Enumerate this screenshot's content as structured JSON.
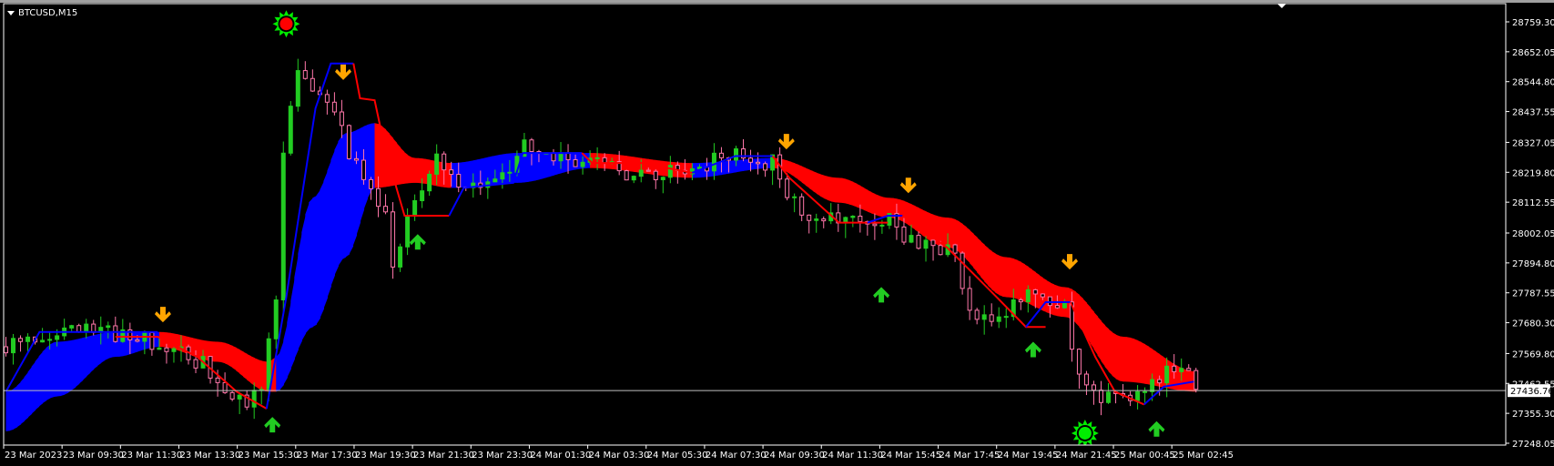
{
  "window": {
    "symbol_title": "BTCUSD,M15"
  },
  "colors": {
    "bull": "#22cc22",
    "bear": "#ff77aa",
    "ribbon_up": "#0000ff",
    "ribbon_down": "#ff0000",
    "arrow_down": "#ffa500",
    "arrow_up": "#22cc22",
    "grid_line": "#c0c0c0"
  },
  "chart_data": {
    "type": "candlestick",
    "symbol": "BTCUSD",
    "timeframe": "M15",
    "ylim": [
      27248.05,
      28759.3
    ],
    "y_ticks": [
      "28759.30",
      "28652.05",
      "28544.80",
      "28437.55",
      "28327.05",
      "28219.80",
      "28112.55",
      "28002.05",
      "27894.80",
      "27787.55",
      "27680.30",
      "27569.80",
      "27462.55",
      "27355.30",
      "27248.05"
    ],
    "current_price": "27436.76",
    "x_labels": [
      "23 Mar 2023",
      "23 Mar 09:30",
      "23 Mar 11:30",
      "23 Mar 13:30",
      "23 Mar 15:30",
      "23 Mar 17:30",
      "23 Mar 19:30",
      "23 Mar 21:30",
      "23 Mar 23:30",
      "24 Mar 01:30",
      "24 Mar 03:30",
      "24 Mar 05:30",
      "24 Mar 07:30",
      "24 Mar 09:30",
      "24 Mar 11:30",
      "24 Mar 15:45",
      "24 Mar 17:45",
      "24 Mar 19:45",
      "24 Mar 21:45",
      "25 Mar 00:45",
      "25 Mar 02:45"
    ],
    "bars_per_label": 8,
    "bar_count": 164,
    "price_path": [
      [
        0,
        27594
      ],
      [
        6,
        27647
      ],
      [
        13,
        27647
      ],
      [
        21,
        27612
      ],
      [
        26,
        27540
      ],
      [
        32,
        27398
      ],
      [
        35,
        27416
      ],
      [
        37,
        27772
      ],
      [
        38,
        28307
      ],
      [
        40,
        28556
      ],
      [
        42,
        28503
      ],
      [
        45,
        28449
      ],
      [
        48,
        28235
      ],
      [
        52,
        28057
      ],
      [
        53,
        27897
      ],
      [
        56,
        28128
      ],
      [
        59,
        28271
      ],
      [
        63,
        28182
      ],
      [
        67,
        28182
      ],
      [
        71,
        28307
      ],
      [
        75,
        28271
      ],
      [
        80,
        28253
      ],
      [
        86,
        28218
      ],
      [
        94,
        28218
      ],
      [
        99,
        28289
      ],
      [
        105,
        28253
      ],
      [
        107,
        28128
      ],
      [
        111,
        28057
      ],
      [
        117,
        28039
      ],
      [
        121,
        28057
      ],
      [
        124,
        27968
      ],
      [
        129,
        27950
      ],
      [
        133,
        27701
      ],
      [
        136,
        27701
      ],
      [
        140,
        27772
      ],
      [
        145,
        27737
      ],
      [
        146,
        27558
      ],
      [
        149,
        27416
      ],
      [
        152,
        27398
      ],
      [
        156,
        27433
      ],
      [
        160,
        27522
      ],
      [
        163,
        27469
      ]
    ],
    "ribbon": [
      [
        0,
        27433,
        27291,
        "up"
      ],
      [
        7,
        27612,
        27416,
        "up"
      ],
      [
        15,
        27647,
        27558,
        "up"
      ],
      [
        21,
        27647,
        27594,
        "down"
      ],
      [
        29,
        27612,
        27540,
        "down"
      ],
      [
        36,
        27540,
        27433,
        "down"
      ],
      [
        37,
        27558,
        27433,
        "up"
      ],
      [
        42,
        28128,
        27665,
        "up"
      ],
      [
        46.5,
        28360,
        27915,
        "up"
      ],
      [
        50.5,
        28396,
        28164,
        "down"
      ],
      [
        56,
        28271,
        28182,
        "down"
      ],
      [
        61,
        28253,
        28164,
        "up"
      ],
      [
        70,
        28289,
        28182,
        "up"
      ],
      [
        80,
        28289,
        28235,
        "down"
      ],
      [
        94,
        28253,
        28200,
        "up"
      ],
      [
        105,
        28271,
        28235,
        "down"
      ],
      [
        114,
        28200,
        28111,
        "down"
      ],
      [
        121,
        28128,
        28057,
        "down"
      ],
      [
        129,
        28057,
        27950,
        "down"
      ],
      [
        137,
        27915,
        27772,
        "down"
      ],
      [
        145,
        27808,
        27701,
        "down"
      ],
      [
        153,
        27630,
        27469,
        "down"
      ],
      [
        163,
        27505,
        27433,
        "down"
      ]
    ],
    "trail_lines": [
      {
        "dir": "up",
        "points": [
          [
            0,
            27433
          ],
          [
            4.6,
            27647
          ],
          [
            20.8,
            27647
          ]
        ]
      },
      {
        "dir": "down",
        "points": [
          [
            15,
            27630
          ],
          [
            20.8,
            27630
          ],
          [
            26.2,
            27558
          ],
          [
            31.6,
            27433
          ],
          [
            35.7,
            27372
          ]
        ]
      },
      {
        "dir": "up",
        "points": [
          [
            35.7,
            27372
          ],
          [
            38.4,
            27772
          ],
          [
            42.4,
            28449
          ],
          [
            44.5,
            28610
          ],
          [
            47.6,
            28610
          ]
        ]
      },
      {
        "dir": "down",
        "points": [
          [
            47.6,
            28610
          ],
          [
            48.5,
            28485
          ],
          [
            50.5,
            28478
          ],
          [
            51.9,
            28307
          ],
          [
            54.6,
            28064
          ],
          [
            60.7,
            28064
          ]
        ]
      },
      {
        "dir": "up",
        "points": [
          [
            60.7,
            28064
          ],
          [
            62.7,
            28164
          ],
          [
            69.5,
            28182
          ],
          [
            70.8,
            28289
          ],
          [
            78.9,
            28289
          ]
        ]
      },
      {
        "dir": "down",
        "points": [
          [
            78.9,
            28289
          ],
          [
            80.3,
            28253
          ],
          [
            87,
            28253
          ],
          [
            94,
            28218
          ]
        ]
      },
      {
        "dir": "up",
        "points": [
          [
            94,
            28218
          ],
          [
            99.9,
            28278
          ],
          [
            105,
            28278
          ]
        ]
      },
      {
        "dir": "down",
        "points": [
          [
            105,
            28278
          ],
          [
            107.3,
            28200
          ],
          [
            114.1,
            28039
          ],
          [
            120.8,
            28039
          ]
        ]
      },
      {
        "dir": "up",
        "points": [
          [
            118,
            28039
          ],
          [
            120.8,
            28064
          ],
          [
            122.8,
            28064
          ]
        ]
      },
      {
        "dir": "down",
        "points": [
          [
            122.8,
            28064
          ],
          [
            128.9,
            27950
          ],
          [
            133,
            27843
          ],
          [
            135.7,
            27772
          ],
          [
            139.7,
            27665
          ],
          [
            142.4,
            27665
          ]
        ]
      },
      {
        "dir": "up",
        "points": [
          [
            139.7,
            27665
          ],
          [
            142.4,
            27754
          ],
          [
            145.8,
            27754
          ]
        ]
      },
      {
        "dir": "down",
        "points": [
          [
            145.8,
            27754
          ],
          [
            149.2,
            27558
          ],
          [
            151.9,
            27433
          ],
          [
            155.9,
            27387
          ]
        ]
      },
      {
        "dir": "up",
        "points": [
          [
            155.9,
            27387
          ],
          [
            158.6,
            27451
          ],
          [
            162.7,
            27469
          ]
        ]
      }
    ],
    "sell_arrows": [
      [
        21.5,
        27708
      ],
      [
        46.2,
        28577
      ],
      [
        106.9,
        28328
      ],
      [
        123.6,
        28171
      ],
      [
        145.7,
        27897
      ]
    ],
    "buy_arrows": [
      [
        36.5,
        27316
      ],
      [
        56.4,
        27972
      ],
      [
        119.9,
        27782
      ],
      [
        140.7,
        27586
      ],
      [
        157.6,
        27301
      ]
    ],
    "sell_signal_marker": [
      38.4,
      28752
    ],
    "buy_signal_marker": [
      147.8,
      27284
    ]
  }
}
